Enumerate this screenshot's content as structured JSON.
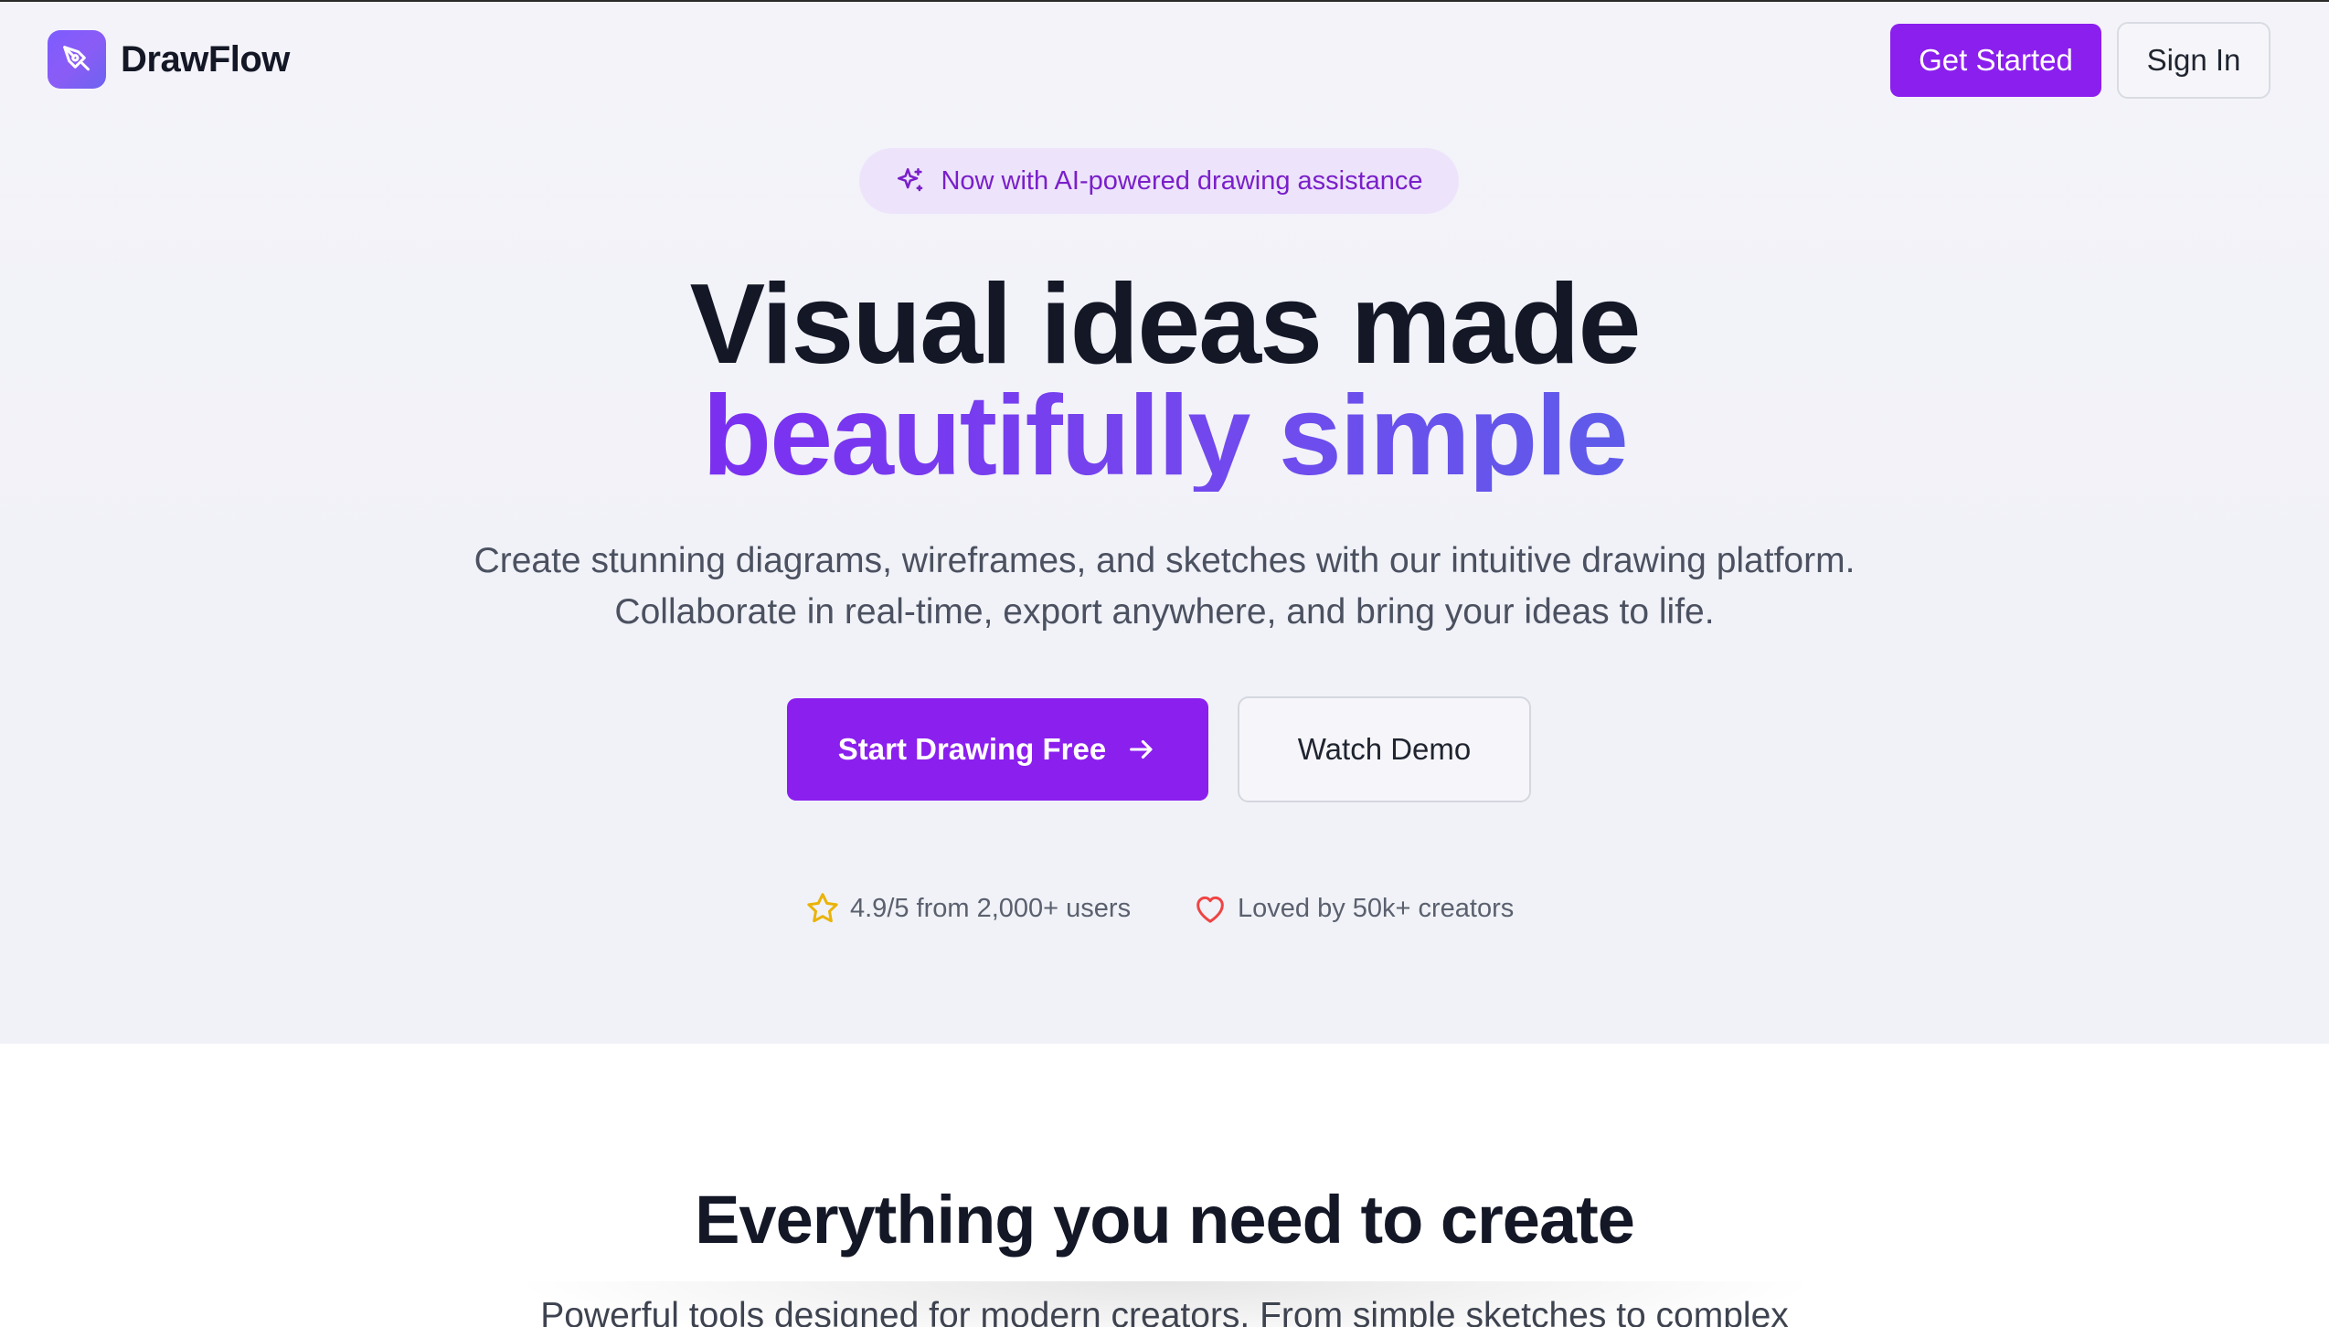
{
  "brand": {
    "name": "DrawFlow",
    "logo_icon": "pen-tool-icon",
    "accent": "#8b1fee"
  },
  "nav": {
    "get_started_label": "Get Started",
    "sign_in_label": "Sign In"
  },
  "badge": {
    "icon": "sparkles-icon",
    "text": "Now with AI-powered drawing assistance"
  },
  "hero": {
    "headline_line1": "Visual ideas made",
    "headline_line2": "beautifully simple",
    "subtitle_line1": "Create stunning diagrams, wireframes, and sketches with our intuitive drawing platform.",
    "subtitle_line2": "Collaborate in real-time, export anywhere, and bring your ideas to life.",
    "cta_primary_label": "Start Drawing Free",
    "cta_primary_icon": "arrow-right-icon",
    "cta_secondary_label": "Watch Demo"
  },
  "social_proof": {
    "rating": {
      "icon": "star-icon",
      "text": "4.9/5 from 2,000+ users",
      "icon_color": "#eab308"
    },
    "loved": {
      "icon": "heart-icon",
      "text": "Loved by 50k+ creators",
      "icon_color": "#ef4444"
    }
  },
  "features": {
    "title": "Everything you need to create",
    "subtitle": "Powerful tools designed for modern creators. From simple sketches to complex"
  }
}
